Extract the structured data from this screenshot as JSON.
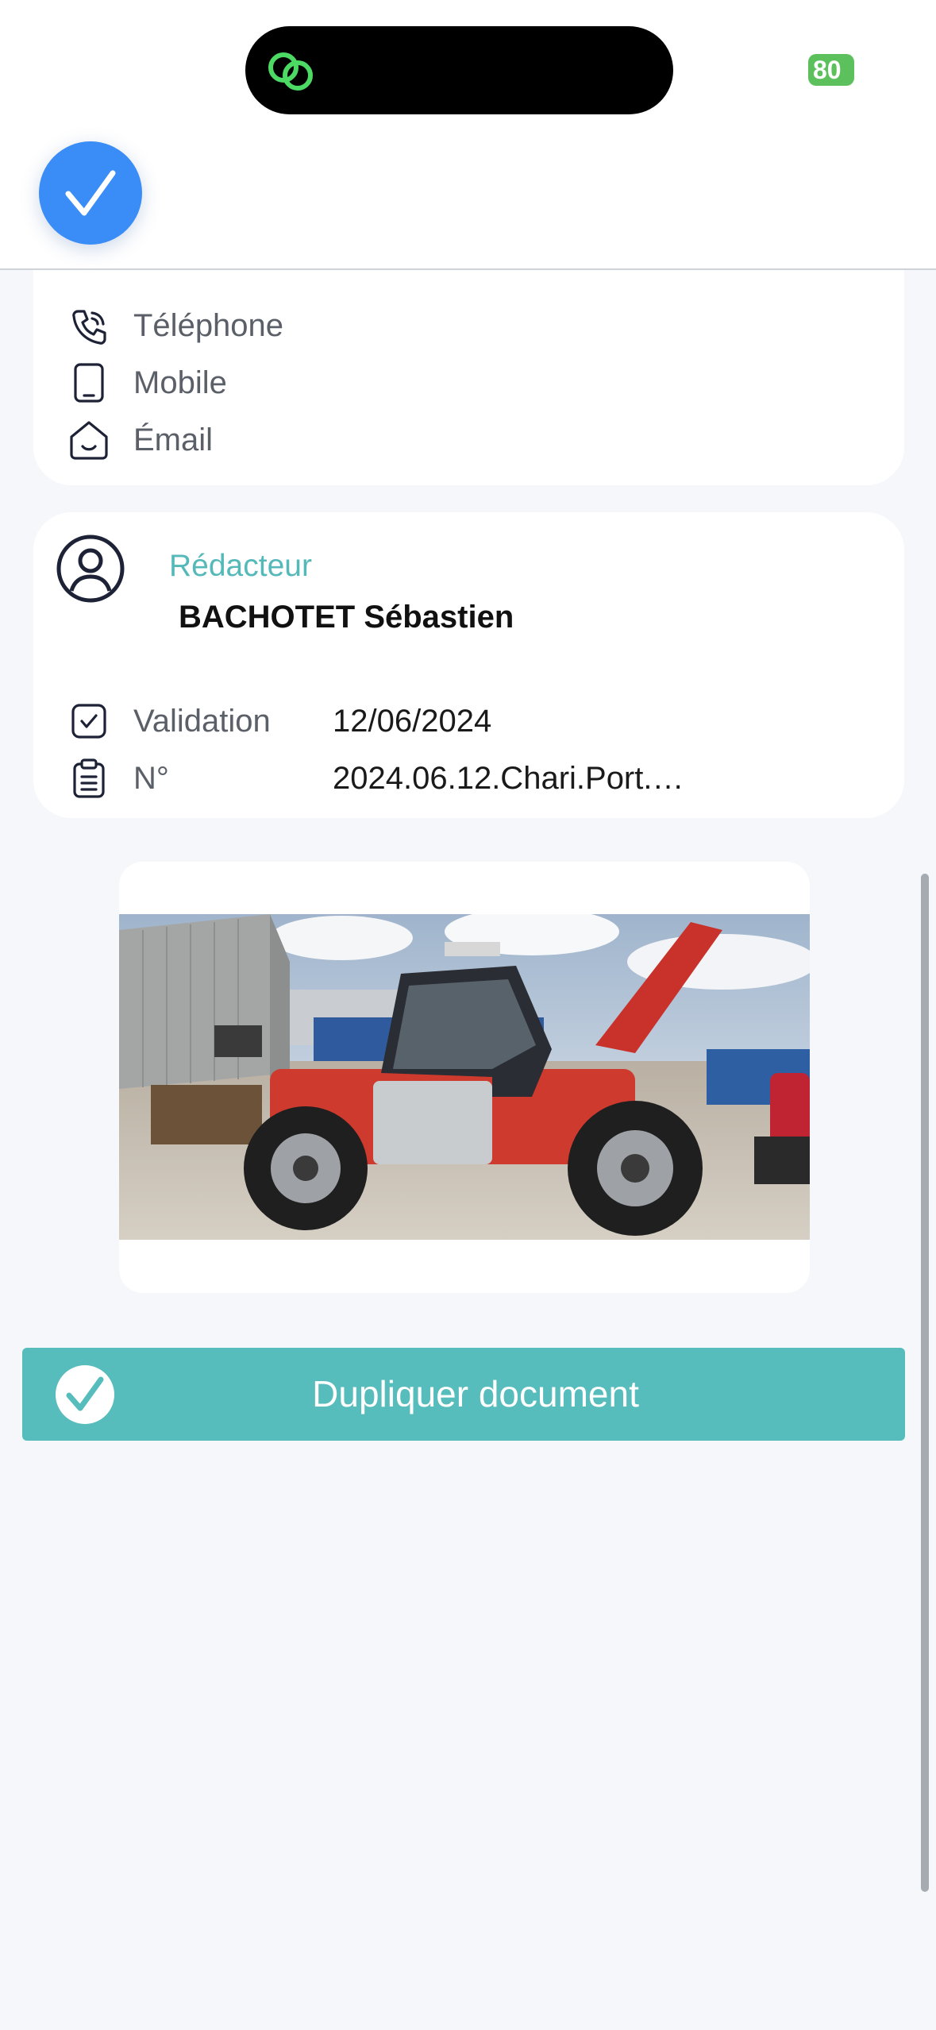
{
  "status_bar": {
    "battery_level": "80",
    "battery_color": "#5cc15d",
    "island_icon": "link-rings-icon"
  },
  "header": {
    "confirm_icon": "checkmark-icon",
    "accent_color": "#3a8df6"
  },
  "contact": {
    "items": [
      {
        "icon": "phone-icon",
        "label": "Téléphone"
      },
      {
        "icon": "mobile-icon",
        "label": "Mobile"
      },
      {
        "icon": "email-icon",
        "label": "Émail"
      }
    ]
  },
  "author": {
    "label": "Rédacteur",
    "name": "BACHOTET Sébastien",
    "details": [
      {
        "icon": "checkbox-icon",
        "label": "Validation",
        "value": "12/06/2024"
      },
      {
        "icon": "clipboard-icon",
        "label": "N°",
        "value": "2024.06.12.Chari.Port.…"
      }
    ]
  },
  "photo": {
    "subject": "red telehandler machine in industrial yard"
  },
  "actions": {
    "duplicate_label": "Dupliquer document",
    "duplicate_color": "#56bcbc"
  }
}
